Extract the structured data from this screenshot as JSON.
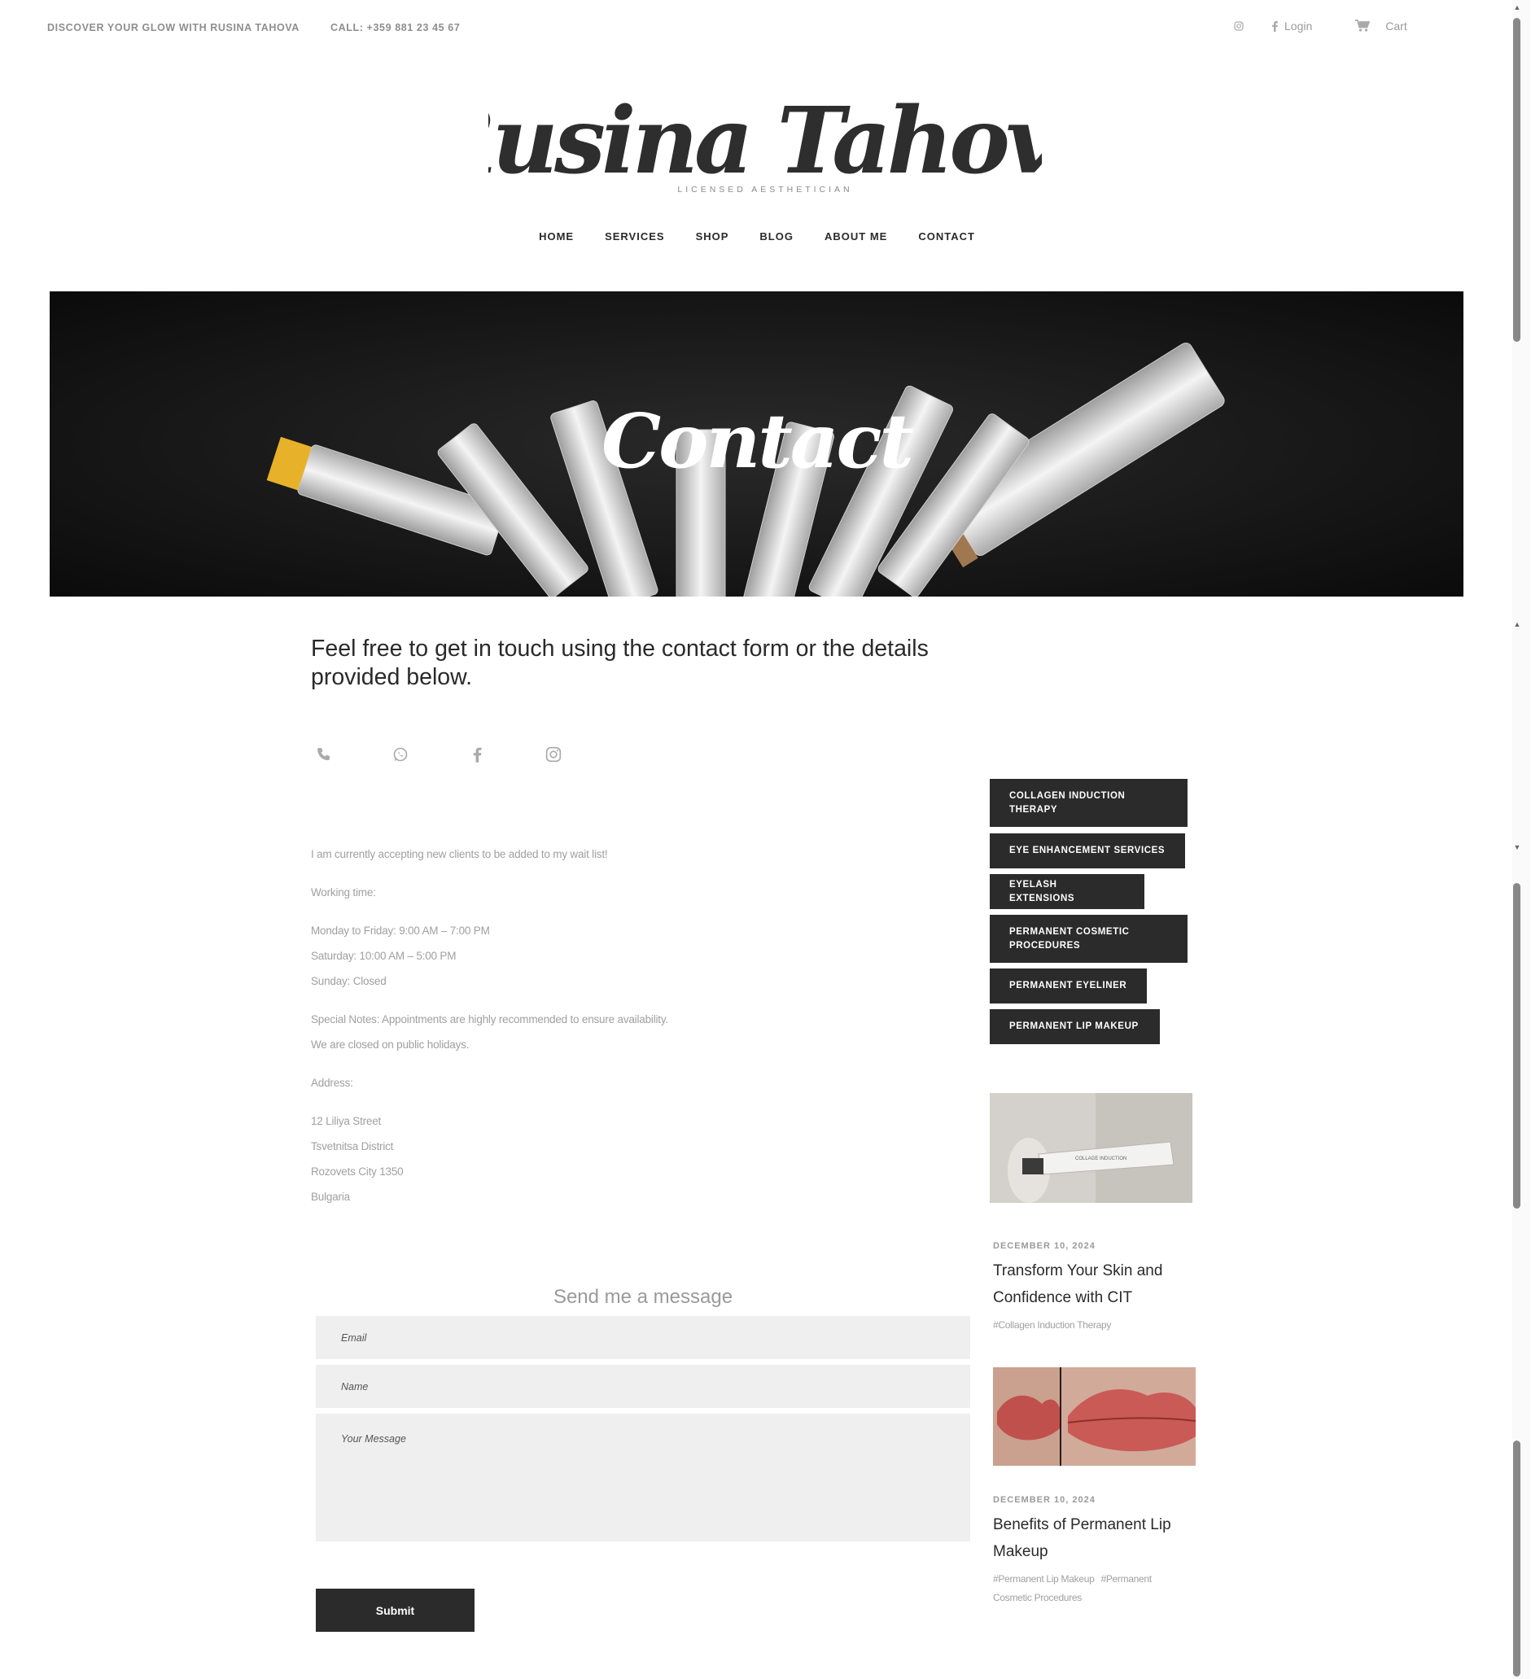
{
  "topbar": {
    "tagline": "DISCOVER YOUR GLOW WITH RUSINA TAHOVA",
    "phone": "CALL: +359 881 23 45 67",
    "login": "Login",
    "cart": "Cart",
    "icons": [
      "instagram-icon",
      "facebook-icon",
      "cart-icon"
    ]
  },
  "logo": {
    "name": "Rusina Tahova",
    "subtitle": "LICENSED AESTHETICIAN"
  },
  "nav": {
    "items": [
      "HOME",
      "SERVICES",
      "SHOP",
      "BLOG",
      "ABOUT ME",
      "CONTACT"
    ]
  },
  "hero": {
    "title": "Contact"
  },
  "intro": {
    "text": "Feel free to get in touch using the contact form or the details provided below."
  },
  "contact_icons": [
    "phone-icon",
    "whatsapp-icon",
    "facebook-icon",
    "instagram-icon"
  ],
  "info": {
    "waitlist": "I am currently accepting new clients to be added to my wait list!",
    "working_label": "Working time:",
    "hours": [
      "Monday to Friday: 9:00 AM – 7:00 PM",
      "Saturday: 10:00 AM – 5:00 PM",
      "Sunday: Closed"
    ],
    "notes": [
      "Special Notes: Appointments are highly recommended to ensure availability.",
      "We are closed on public holidays."
    ],
    "address_label": "Address:",
    "address": [
      "12 Liliya Street",
      "Tsvetnitsa District",
      "Rozovets City 1350",
      "Bulgaria"
    ]
  },
  "form": {
    "title": "Send me a message",
    "email_placeholder": "Email",
    "name_placeholder": "Name",
    "message_placeholder": "Your Message",
    "submit": "Submit"
  },
  "sidebar": {
    "tags": [
      "COLLAGEN INDUCTION THERAPY",
      "EYE ENHANCEMENT SERVICES",
      "EYELASH EXTENSIONS",
      "PERMANENT COSMETIC PROCEDURES",
      "PERMANENT EYELINER",
      "PERMANENT LIP MAKEUP"
    ],
    "posts": [
      {
        "date": "DECEMBER 10, 2024",
        "title": "Transform Your Skin and Confidence with CIT",
        "tags": [
          "#Collagen Induction Therapy"
        ],
        "image_text": "COLLAGE INDUCTION"
      },
      {
        "date": "DECEMBER 10, 2024",
        "title": "Benefits of Permanent Lip Makeup",
        "tags": [
          "#Permanent Lip Makeup",
          "#Permanent Cosmetic Procedures"
        ]
      }
    ]
  },
  "colors": {
    "dark": "#2b2b2b",
    "muted": "#a0a0a0",
    "field_bg": "#efefef"
  }
}
